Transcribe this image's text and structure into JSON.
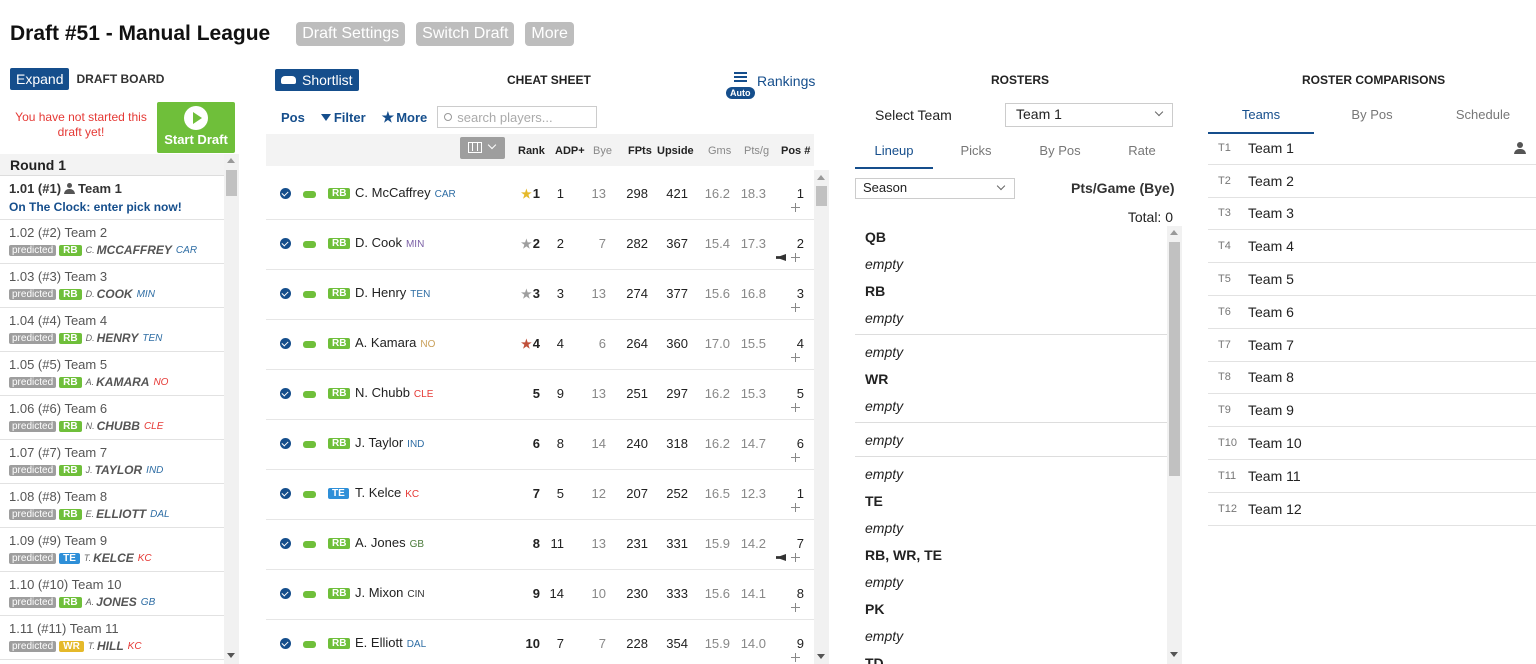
{
  "header": {
    "title": "Draft #51 - Manual League",
    "buttons": [
      "Draft Settings",
      "Switch Draft",
      "More"
    ]
  },
  "board": {
    "expand_label": "Expand",
    "title": "DRAFT BOARD",
    "not_started": "You have not started this draft yet!",
    "start_label": "Start Draft",
    "round_label": "Round 1",
    "current_pick": {
      "slot": "1.01 (#1)",
      "team": "Team 1",
      "status": "On The Clock: enter pick now!"
    },
    "picks": [
      {
        "slot": "1.02 (#2)",
        "team": "Team 2",
        "tag": "predicted",
        "pos": "RB",
        "init": "C.",
        "name": "MCCAFFREY",
        "nfl": "CAR"
      },
      {
        "slot": "1.03 (#3)",
        "team": "Team 3",
        "tag": "predicted",
        "pos": "RB",
        "init": "D.",
        "name": "COOK",
        "nfl": "MIN"
      },
      {
        "slot": "1.04 (#4)",
        "team": "Team 4",
        "tag": "predicted",
        "pos": "RB",
        "init": "D.",
        "name": "HENRY",
        "nfl": "TEN"
      },
      {
        "slot": "1.05 (#5)",
        "team": "Team 5",
        "tag": "predicted",
        "pos": "RB",
        "init": "A.",
        "name": "KAMARA",
        "nfl": "NO"
      },
      {
        "slot": "1.06 (#6)",
        "team": "Team 6",
        "tag": "predicted",
        "pos": "RB",
        "init": "N.",
        "name": "CHUBB",
        "nfl": "CLE"
      },
      {
        "slot": "1.07 (#7)",
        "team": "Team 7",
        "tag": "predicted",
        "pos": "RB",
        "init": "J.",
        "name": "TAYLOR",
        "nfl": "IND"
      },
      {
        "slot": "1.08 (#8)",
        "team": "Team 8",
        "tag": "predicted",
        "pos": "RB",
        "init": "E.",
        "name": "ELLIOTT",
        "nfl": "DAL"
      },
      {
        "slot": "1.09 (#9)",
        "team": "Team 9",
        "tag": "predicted",
        "pos": "TE",
        "init": "T.",
        "name": "KELCE",
        "nfl": "KC"
      },
      {
        "slot": "1.10 (#10)",
        "team": "Team 10",
        "tag": "predicted",
        "pos": "RB",
        "init": "A.",
        "name": "JONES",
        "nfl": "GB"
      },
      {
        "slot": "1.11 (#11)",
        "team": "Team 11",
        "tag": "predicted",
        "pos": "WR",
        "init": "T.",
        "name": "HILL",
        "nfl": "KC"
      }
    ]
  },
  "cheat": {
    "shortlist_label": "Shortlist",
    "title": "CHEAT SHEET",
    "rankings_label": "Rankings",
    "auto_badge": "Auto",
    "pos_label": "Pos",
    "filter_label": "Filter",
    "more_label": "More",
    "search_placeholder": "search players...",
    "columns": {
      "rank": "Rank",
      "adp": "ADP+",
      "bye": "Bye",
      "fpts": "FPts",
      "upside": "Upside",
      "gms": "Gms",
      "ptsg": "Pts/g",
      "posn": "Pos #"
    },
    "players": [
      {
        "pos": "RB",
        "name": "C. McCaffrey",
        "nfl": "CAR",
        "rank": "1",
        "star": "gold",
        "adp": "1",
        "bye": "13",
        "fpts": "298",
        "upside": "421",
        "gms": "16.2",
        "ptsg": "18.3",
        "posn": "1",
        "alert": false
      },
      {
        "pos": "RB",
        "name": "D. Cook",
        "nfl": "MIN",
        "rank": "2",
        "star": "gray",
        "adp": "2",
        "bye": "7",
        "fpts": "282",
        "upside": "367",
        "gms": "15.4",
        "ptsg": "17.3",
        "posn": "2",
        "alert": true
      },
      {
        "pos": "RB",
        "name": "D. Henry",
        "nfl": "TEN",
        "rank": "3",
        "star": "gray",
        "adp": "3",
        "bye": "13",
        "fpts": "274",
        "upside": "377",
        "gms": "15.6",
        "ptsg": "16.8",
        "posn": "3",
        "alert": false
      },
      {
        "pos": "RB",
        "name": "A. Kamara",
        "nfl": "NO",
        "rank": "4",
        "star": "red",
        "adp": "4",
        "bye": "6",
        "fpts": "264",
        "upside": "360",
        "gms": "17.0",
        "ptsg": "15.5",
        "posn": "4",
        "alert": false
      },
      {
        "pos": "RB",
        "name": "N. Chubb",
        "nfl": "CLE",
        "rank": "5",
        "star": "",
        "adp": "9",
        "bye": "13",
        "fpts": "251",
        "upside": "297",
        "gms": "16.2",
        "ptsg": "15.3",
        "posn": "5",
        "alert": false
      },
      {
        "pos": "RB",
        "name": "J. Taylor",
        "nfl": "IND",
        "rank": "6",
        "star": "",
        "adp": "8",
        "bye": "14",
        "fpts": "240",
        "upside": "318",
        "gms": "16.2",
        "ptsg": "14.7",
        "posn": "6",
        "alert": false
      },
      {
        "pos": "TE",
        "name": "T. Kelce",
        "nfl": "KC",
        "rank": "7",
        "star": "",
        "adp": "5",
        "bye": "12",
        "fpts": "207",
        "upside": "252",
        "gms": "16.5",
        "ptsg": "12.3",
        "posn": "1",
        "alert": false
      },
      {
        "pos": "RB",
        "name": "A. Jones",
        "nfl": "GB",
        "rank": "8",
        "star": "",
        "adp": "11",
        "bye": "13",
        "fpts": "231",
        "upside": "331",
        "gms": "15.9",
        "ptsg": "14.2",
        "posn": "7",
        "alert": true
      },
      {
        "pos": "RB",
        "name": "J. Mixon",
        "nfl": "CIN",
        "rank": "9",
        "star": "",
        "adp": "14",
        "bye": "10",
        "fpts": "230",
        "upside": "333",
        "gms": "15.6",
        "ptsg": "14.1",
        "posn": "8",
        "alert": false
      },
      {
        "pos": "RB",
        "name": "E. Elliott",
        "nfl": "DAL",
        "rank": "10",
        "star": "",
        "adp": "7",
        "bye": "7",
        "fpts": "228",
        "upside": "354",
        "gms": "15.9",
        "ptsg": "14.0",
        "posn": "9",
        "alert": false
      }
    ]
  },
  "rosters": {
    "title": "ROSTERS",
    "select_label": "Select Team",
    "selected_team": "Team 1",
    "tabs": [
      "Lineup",
      "Picks",
      "By Pos",
      "Rate"
    ],
    "active_tab": "Lineup",
    "period": "Season",
    "ppg_label": "Pts/Game (Bye)",
    "total": "Total: 0",
    "slots": [
      {
        "label": "QB",
        "empties": [
          "empty"
        ]
      },
      {
        "label": "RB",
        "empties": [
          "empty",
          "empty"
        ]
      },
      {
        "label": "WR",
        "empties": [
          "empty",
          "empty",
          "empty"
        ]
      },
      {
        "label": "TE",
        "empties": [
          "empty"
        ]
      },
      {
        "label": "RB, WR, TE",
        "empties": [
          "empty"
        ]
      },
      {
        "label": "PK",
        "empties": [
          "empty"
        ]
      },
      {
        "label": "TD",
        "empties": []
      }
    ]
  },
  "comparisons": {
    "title": "ROSTER COMPARISONS",
    "tabs": [
      "Teams",
      "By Pos",
      "Schedule"
    ],
    "active_tab": "Teams",
    "teams": [
      {
        "id": "T1",
        "name": "Team 1",
        "mine": true
      },
      {
        "id": "T2",
        "name": "Team 2"
      },
      {
        "id": "T3",
        "name": "Team 3"
      },
      {
        "id": "T4",
        "name": "Team 4"
      },
      {
        "id": "T5",
        "name": "Team 5"
      },
      {
        "id": "T6",
        "name": "Team 6"
      },
      {
        "id": "T7",
        "name": "Team 7"
      },
      {
        "id": "T8",
        "name": "Team 8"
      },
      {
        "id": "T9",
        "name": "Team 9"
      },
      {
        "id": "T10",
        "name": "Team 10"
      },
      {
        "id": "T11",
        "name": "Team 11"
      },
      {
        "id": "T12",
        "name": "Team 12"
      }
    ]
  },
  "colors": {
    "primary": "#154e8c",
    "rb": "#6fbf3a",
    "te": "#2e8fd8",
    "wr": "#e5b92a",
    "alert": "#e53935",
    "team_link": "#2e6da4",
    "team_alert": "#e53935"
  }
}
